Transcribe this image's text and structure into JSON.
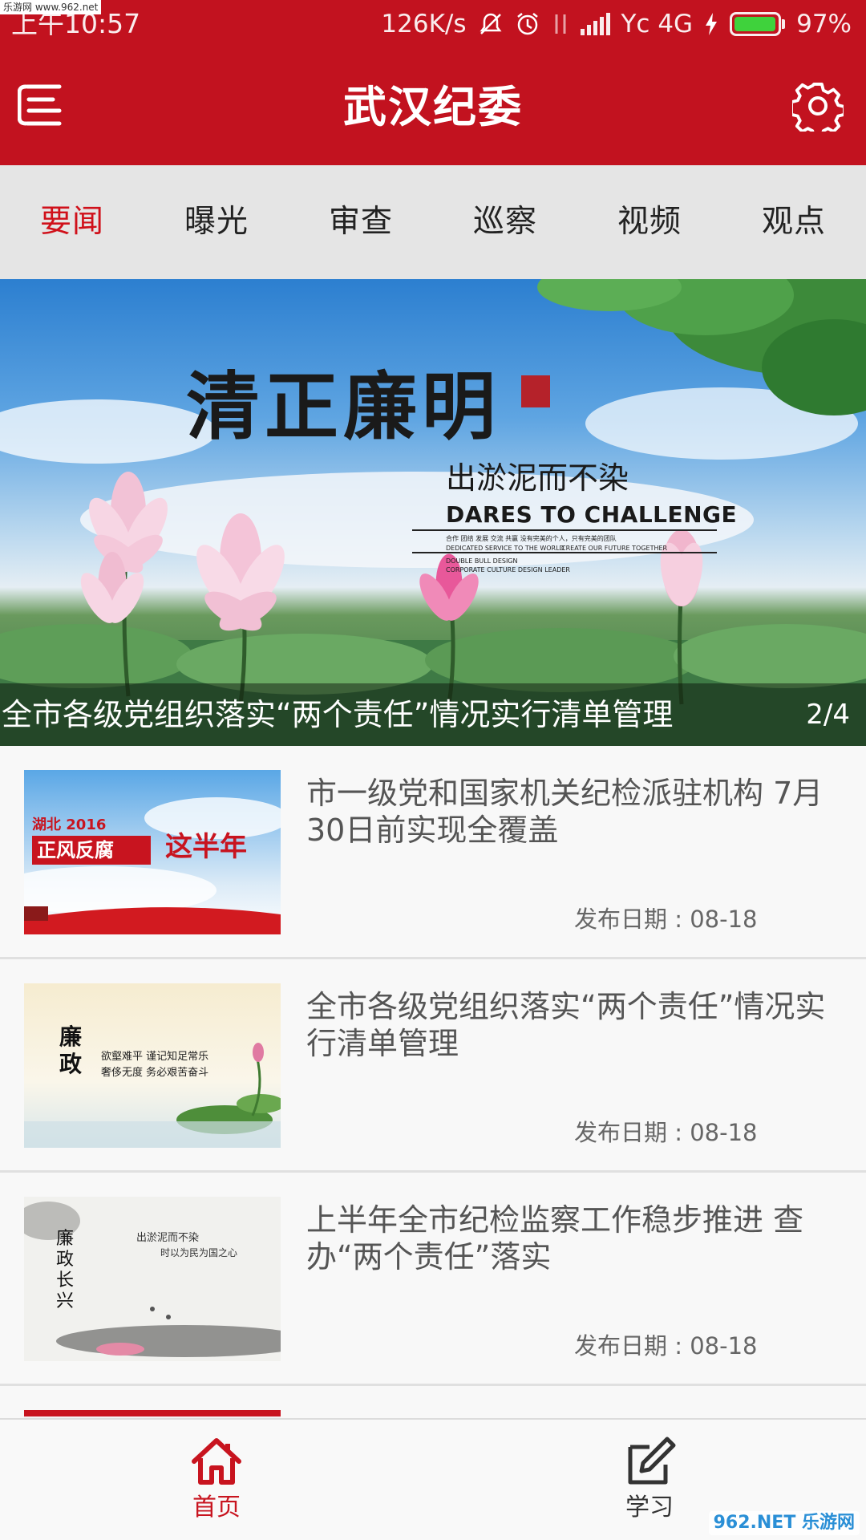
{
  "watermark": {
    "top": "乐游网 www.962.net",
    "bottom": "962.NET 乐游网"
  },
  "status_bar": {
    "time": "上午10:57",
    "net_speed": "126K/s",
    "carrier": "Yc 4G",
    "battery": "97%",
    "battery_level": 0.97,
    "battery_color": "#3fd23c"
  },
  "app_bar": {
    "title": "武汉纪委",
    "menu_icon": "menu-icon",
    "settings_icon": "gear-icon"
  },
  "tabs": [
    {
      "label": "要闻",
      "active": true
    },
    {
      "label": "曝光",
      "active": false
    },
    {
      "label": "审查",
      "active": false
    },
    {
      "label": "巡察",
      "active": false
    },
    {
      "label": "视频",
      "active": false
    },
    {
      "label": "观点",
      "active": false
    }
  ],
  "banner": {
    "headline": "清正廉明",
    "subhead": "出淤泥而不染",
    "english": "DARES TO CHALLENGE",
    "small_line_1": "合作  团结  发展  交流  共赢  没有完美的个人，只有完美的团队",
    "small_line_2": "DEDICATED SERVICE TO THE WORLD",
    "small_line_3": "CREATE OUR FUTURE TOGETHER",
    "small_line_4": "DOUBLE BULL DESIGN",
    "small_line_5": "CORPORATE CULTURE DESIGN LEADER",
    "caption": "全市各级党组织落实“两个责任”情况实行清单管理",
    "counter": "2/4"
  },
  "news": [
    {
      "title": "市一级党和国家机关纪检派驻机构 7月30日前实现全覆盖",
      "date": "发布日期 : 08-18",
      "thumb_text_1": "湖北 2016",
      "thumb_text_2": "正风反腐",
      "thumb_text_3": "这半年"
    },
    {
      "title": "全市各级党组织落实“两个责任”情况实行清单管理",
      "date": "发布日期 : 08-18",
      "thumb_text_1": "廉政",
      "thumb_text_2": "欲壑难平  谨记知足常乐",
      "thumb_text_3": "奢侈无度  务必艰苦奋斗"
    },
    {
      "title": "上半年全市纪检监察工作稳步推进 查办“两个责任”落实",
      "date": "发布日期 : 08-18",
      "thumb_text_1": "廉政长兴",
      "thumb_text_2": "出淤泥而不染",
      "thumb_text_3": "时以为民为国之心"
    }
  ],
  "bottom_nav": [
    {
      "label": "首页",
      "icon": "home-icon",
      "active": true,
      "color": "#c8141f"
    },
    {
      "label": "学习",
      "icon": "edit-icon",
      "active": false,
      "color": "#333333"
    }
  ]
}
